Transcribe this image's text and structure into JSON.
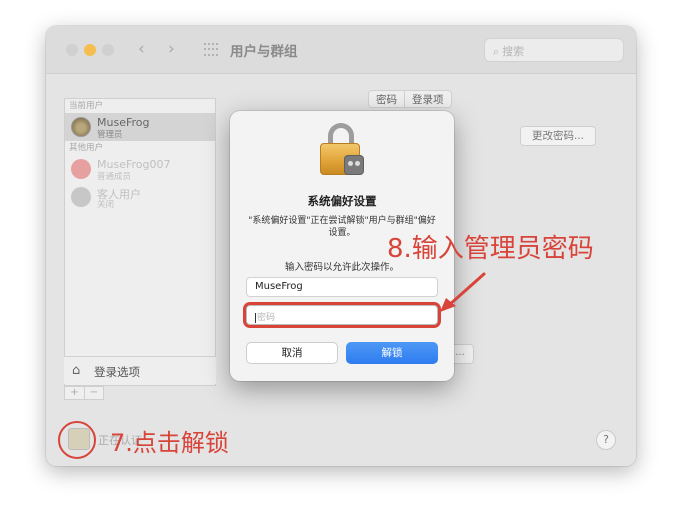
{
  "window": {
    "title": "用户与群组",
    "search_placeholder": "搜索",
    "nav_back": "‹",
    "nav_forward": "›"
  },
  "sidebar": {
    "section_current": "当前用户",
    "current_user": {
      "name": "MuseFrog",
      "role": "管理员"
    },
    "section_other": "其他用户",
    "other_users": [
      {
        "name": "MuseFrog007",
        "role": "普通成员"
      },
      {
        "name": "客人用户",
        "role": "关闭"
      }
    ],
    "login_options": "登录选项",
    "add": "+",
    "remove": "−"
  },
  "main": {
    "tabs": [
      "密码",
      "登录项"
    ],
    "change_password": "更改密码...",
    "ghost_button": "...",
    "lock_text": "正在认证",
    "help": "?"
  },
  "dialog": {
    "title": "系统偏好设置",
    "message": "\"系统偏好设置\"正在尝试解锁\"用户与群组\"偏好设置。",
    "prompt": "输入密码以允许此次操作。",
    "username_value": "MuseFrog",
    "password_placeholder": "密码",
    "cancel_label": "取消",
    "unlock_label": "解锁"
  },
  "annotations": {
    "step8": "8.输入管理员密码",
    "step7": "7.点击解锁",
    "color": "#d8443a"
  },
  "icons": {
    "lock": "padlock-icon",
    "home": "house-icon",
    "search": "magnifier-icon",
    "grid": "grid-icon"
  }
}
